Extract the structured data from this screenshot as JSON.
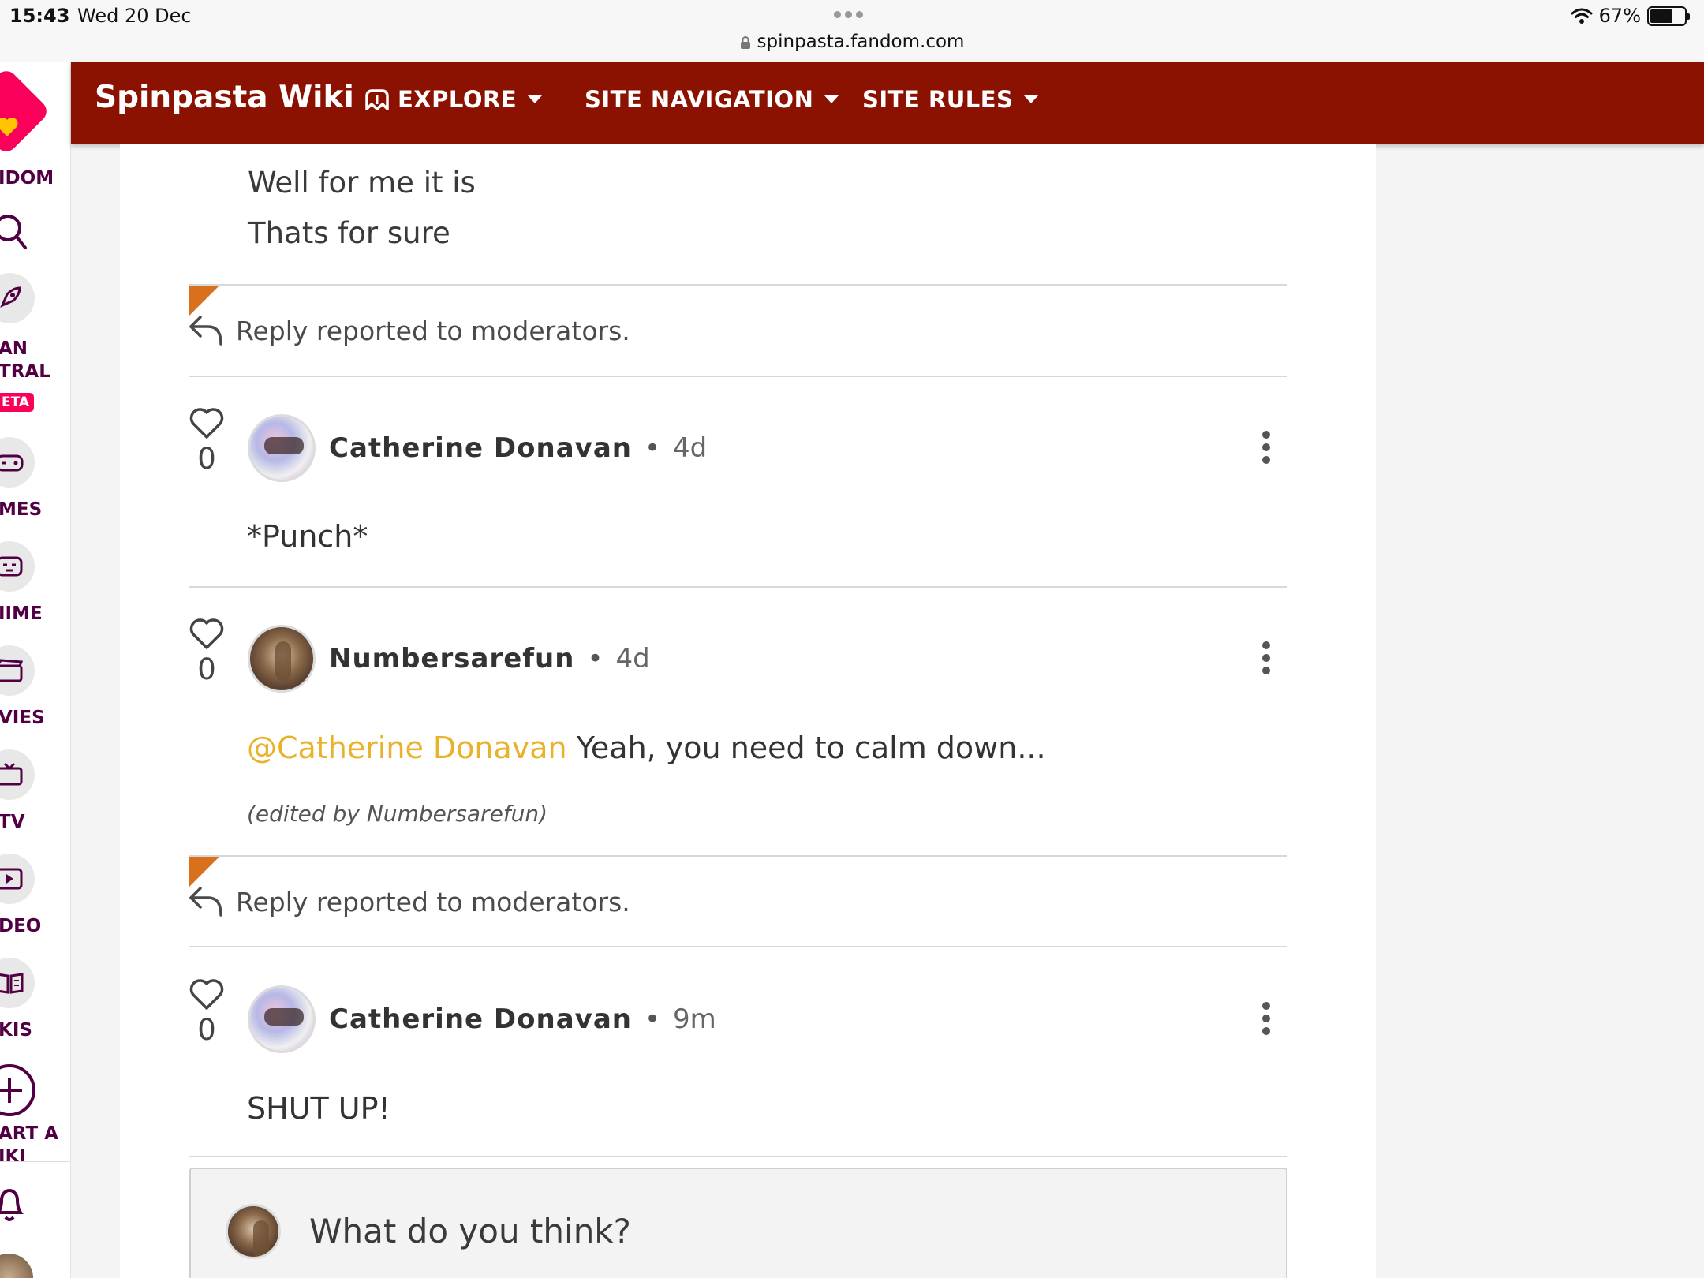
{
  "status_bar": {
    "time": "15:43",
    "date": "Wed 20 Dec",
    "url": "spinpasta.fandom.com",
    "battery": "67%",
    "battery_level": 0.67
  },
  "fandom_rail": {
    "items": [
      {
        "label": "IDOM",
        "icon": "fandom-logo"
      },
      {
        "label": "",
        "icon": "search-icon"
      },
      {
        "label": "AN",
        "label2": "TRAL",
        "badge": "ETA",
        "icon": "rocket-icon"
      },
      {
        "label": "MES",
        "icon": "gamepad-icon"
      },
      {
        "label": "IIME",
        "icon": "anime-icon"
      },
      {
        "label": "VIES",
        "icon": "clapperboard-icon"
      },
      {
        "label": "TV",
        "icon": "tv-icon"
      },
      {
        "label": "DEO",
        "icon": "play-icon"
      },
      {
        "label": "KIS",
        "icon": "book-icon"
      },
      {
        "label": "ART A",
        "label2": "IKI",
        "icon": "plus-circle-icon"
      },
      {
        "label": "",
        "icon": "bell-icon"
      }
    ]
  },
  "header": {
    "wiki_title": "Spinpasta Wiki",
    "nav": [
      {
        "label": "EXPLORE",
        "icon": "explore-icon"
      },
      {
        "label": "SITE NAVIGATION"
      },
      {
        "label": "SITE RULES"
      }
    ]
  },
  "thread": {
    "top_lines": [
      "Well for me it is",
      "Thats for sure"
    ],
    "reported_text": "Reply reported to moderators.",
    "replies": [
      {
        "author": "Catherine Donavan",
        "time": "4d",
        "likes": "0",
        "body": "*Punch*"
      },
      {
        "author": "Numbersarefun",
        "time": "4d",
        "likes": "0",
        "mention": "@Catherine Donavan",
        "body": " Yeah, you need to calm down...",
        "edited": "(edited by Numbersarefun)"
      },
      {
        "author": "Catherine Donavan",
        "time": "9m",
        "likes": "0",
        "body": "SHUT UP!"
      }
    ],
    "composer_placeholder": "What do you think?"
  },
  "colors": {
    "header_bg": "#8b1200",
    "fandom_pink": "#fa005a",
    "fandom_purple": "#520044",
    "mention": "#e8b22a",
    "report_flag": "#d8701c"
  }
}
